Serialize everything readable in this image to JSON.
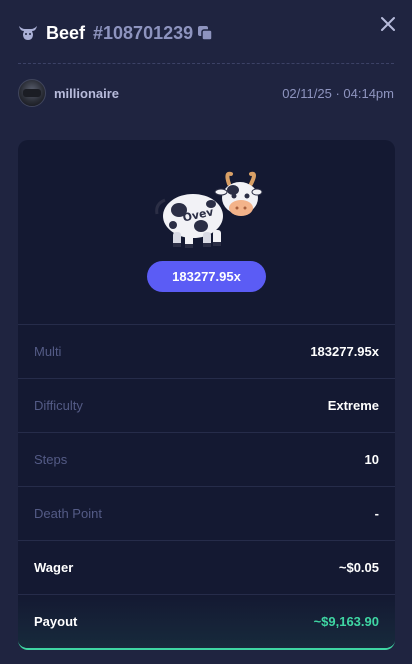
{
  "header": {
    "game_name": "Beef",
    "bet_id": "#108701239",
    "icons": {
      "game": "bull-head-icon",
      "copy": "copy-icon",
      "close": "close-icon"
    }
  },
  "user": {
    "name": "millionaire",
    "timestamp": "02/11/25 · 04:14pm"
  },
  "result": {
    "multiplier": "183277.95x",
    "rows": [
      {
        "label": "Multi",
        "value": "183277.95x"
      },
      {
        "label": "Difficulty",
        "value": "Extreme"
      },
      {
        "label": "Steps",
        "value": "10"
      },
      {
        "label": "Death Point",
        "value": "-"
      },
      {
        "label": "Wager",
        "value": "~$0.05"
      },
      {
        "label": "Payout",
        "value": "~$9,163.90"
      }
    ]
  },
  "colors": {
    "background": "#1f2440",
    "card": "#141932",
    "accent": "#5b5cf5",
    "payout": "#3fd6a3",
    "muted": "#8e94bf"
  }
}
